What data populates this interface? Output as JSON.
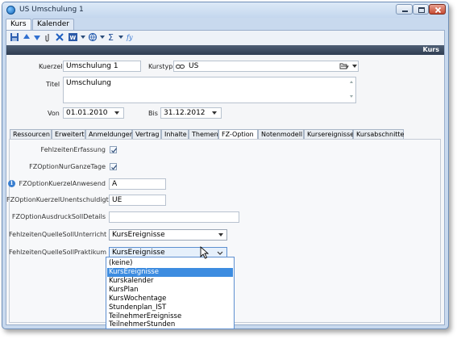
{
  "window": {
    "title": "US Umschulung 1",
    "buttons": {
      "minimize": "minimize-icon",
      "maximize": "maximize-icon",
      "close": "close-icon"
    }
  },
  "top_tabs": [
    {
      "label": "Kurs",
      "active": true
    },
    {
      "label": "Kalender",
      "active": false
    }
  ],
  "toolbar": {
    "icons": [
      "save-icon",
      "arrow-up-icon",
      "arrow-down-icon",
      "attachment-icon",
      "delete-icon",
      "word-icon",
      "globe-icon",
      "sum-icon",
      "formula-icon"
    ]
  },
  "header": {
    "label": "Kurs"
  },
  "form": {
    "kuerzel_label": "Kuerzel",
    "kuerzel_value": "Umschulung 1",
    "kurstyp_label": "Kurstyp",
    "kurstyp_value": "US",
    "titel_label": "Titel",
    "titel_value": "Umschulung",
    "von_label": "Von",
    "von_value": "01.01.2010",
    "bis_label": "Bis",
    "bis_value": "31.12.2012"
  },
  "section_tabs": [
    {
      "label": "Ressourcen",
      "active": false
    },
    {
      "label": "Erweitert",
      "active": false
    },
    {
      "label": "Anmeldungen",
      "active": false
    },
    {
      "label": "Vertrag",
      "active": false
    },
    {
      "label": "Inhalte",
      "active": false
    },
    {
      "label": "Themen",
      "active": false
    },
    {
      "label": "FZ-Option",
      "active": true
    },
    {
      "label": "Notenmodell",
      "active": false
    },
    {
      "label": "Kursereignisse",
      "active": false
    },
    {
      "label": "Kursabschnitte",
      "active": false
    }
  ],
  "fz": {
    "erfassung_label": "FehlzeitenErfassung",
    "erfassung_checked": true,
    "ganzetage_label": "FZOptionNurGanzeTage",
    "ganzetage_checked": true,
    "anwesend_label": "FZOptionKuerzelAnwesend",
    "anwesend_value": "A",
    "unentschuldigt_label": "FZOptionKuerzelUnentschuldigt",
    "unentschuldigt_value": "UE",
    "ausdruck_label": "FZOptionAusdruckSollDetails",
    "ausdruck_value": "",
    "quelle_unterricht_label": "FehlzeitenQuelleSollUnterricht",
    "quelle_unterricht_value": "KursEreignisse",
    "quelle_praktikum_label": "FehlzeitenQuelleSollPraktikum",
    "quelle_praktikum_value": "KursEreignisse"
  },
  "dropdown_options": [
    {
      "label": "(keine)",
      "selected": false
    },
    {
      "label": "KursEreignisse",
      "selected": true
    },
    {
      "label": "Kurskalender",
      "selected": false
    },
    {
      "label": "KursPlan",
      "selected": false
    },
    {
      "label": "KursWochentage",
      "selected": false
    },
    {
      "label": "Stundenplan_IST",
      "selected": false
    },
    {
      "label": "TeilnehmerEreignisse",
      "selected": false
    },
    {
      "label": "TeilnehmerStunden",
      "selected": false
    }
  ]
}
